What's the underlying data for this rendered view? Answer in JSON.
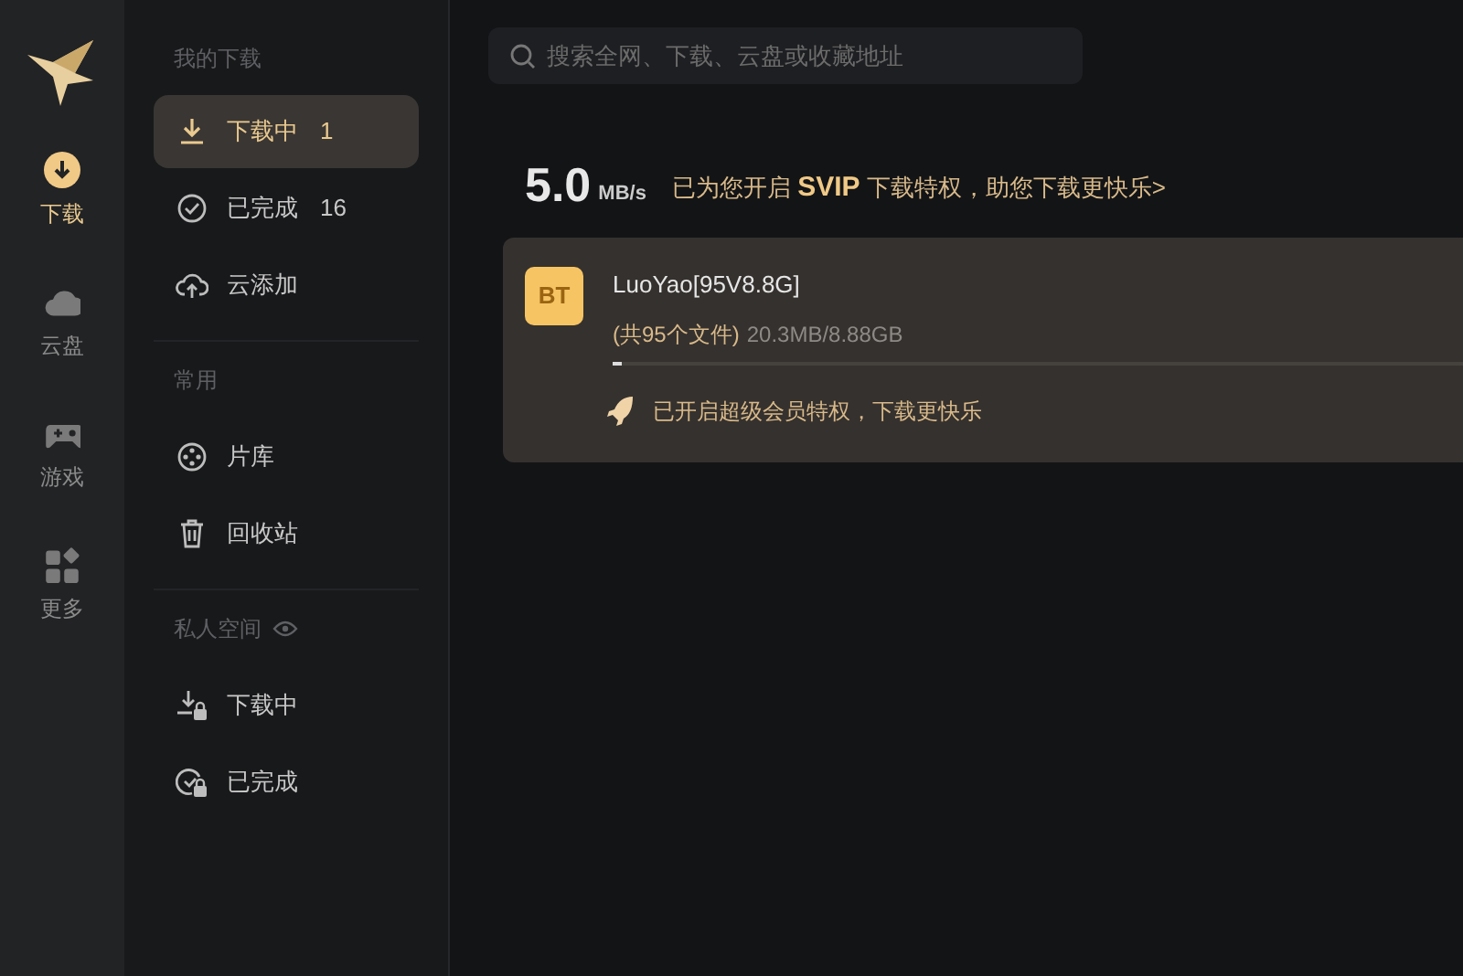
{
  "rail": [
    {
      "label": "下载",
      "kind": "download",
      "selected": true
    },
    {
      "label": "云盘",
      "kind": "cloud",
      "selected": false
    },
    {
      "label": "游戏",
      "kind": "gamepad",
      "selected": false
    },
    {
      "label": "更多",
      "kind": "apps",
      "selected": false
    }
  ],
  "sidebar": [
    {
      "title": "我的下载",
      "items": [
        {
          "label": "下载中",
          "count": "1",
          "kind": "download",
          "selected": true
        },
        {
          "label": "已完成",
          "count": "16",
          "kind": "check",
          "selected": false
        },
        {
          "label": "云添加",
          "kind": "cloud-up",
          "selected": false
        }
      ]
    },
    {
      "title": "常用",
      "items": [
        {
          "label": "片库",
          "kind": "film",
          "selected": false
        },
        {
          "label": "回收站",
          "kind": "trash",
          "selected": false
        }
      ]
    },
    {
      "title": "私人空间",
      "eye": true,
      "items": [
        {
          "label": "下载中",
          "kind": "download-lock",
          "selected": false
        },
        {
          "label": "已完成",
          "kind": "check-lock",
          "selected": false
        }
      ]
    }
  ],
  "search": {
    "placeholder": "搜索全网、下载、云盘或收藏地址"
  },
  "speed": {
    "value": "5.0",
    "unit": "MB/s",
    "promo": "已为您开启 **SVIP** 下载特权，助您下载更快乐>"
  },
  "tasks": [
    {
      "badge": "BT",
      "name": "LuoYao[95V8.8G]",
      "files": "(共95个文件)",
      "size": "20.3MB/8.88GB",
      "level": 0.01,
      "note": "已开启超级会员特权，下载更快乐"
    }
  ]
}
